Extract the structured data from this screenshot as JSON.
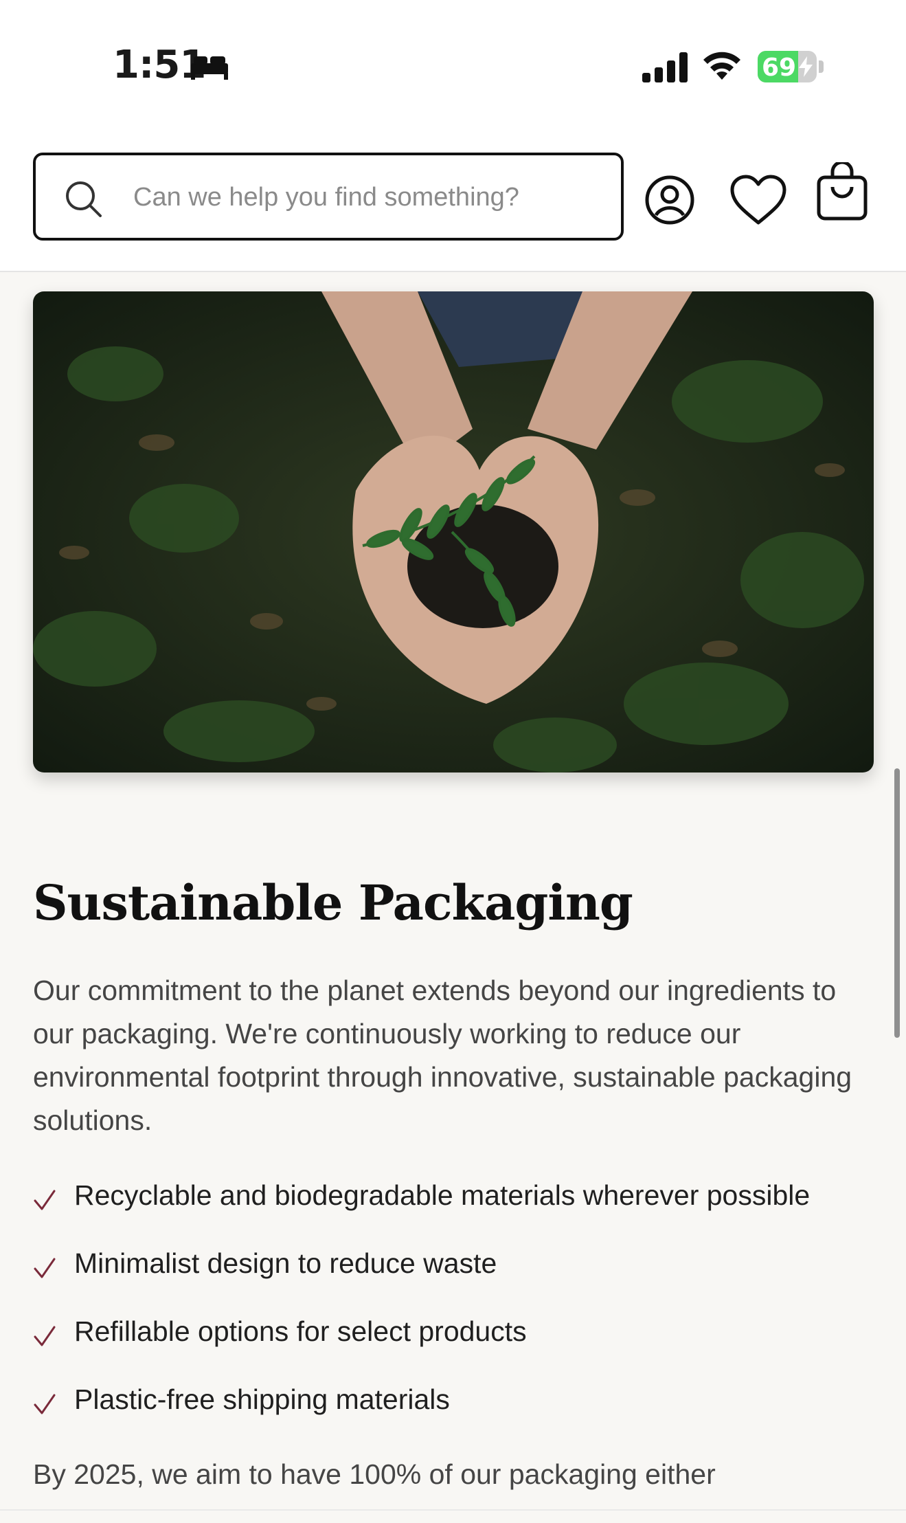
{
  "status_bar": {
    "time": "1:51",
    "battery_percent": "69",
    "battery_level": 0.69
  },
  "header": {
    "search_placeholder": "Can we help you find something?",
    "icons": [
      "search-icon",
      "account-icon",
      "heart-icon",
      "shopping-bag-icon"
    ]
  },
  "hero": {
    "description_icon": "hands-holding-seedling-photo"
  },
  "section": {
    "title": "Sustainable Packaging",
    "body": "Our commitment to the planet extends beyond our ingredients to our packaging. We're continuously working to reduce our environmental footprint through innovative, sustainable packaging solutions.",
    "features": [
      "Recyclable and biodegradable materials wherever possible",
      "Minimalist design to reduce waste",
      "Refillable options for select products",
      "Plastic-free shipping materials"
    ],
    "footer": "By 2025, we aim to have 100% of our packaging either"
  },
  "colors": {
    "accent_check": "#7a2a3a",
    "background": "#f8f7f4"
  }
}
